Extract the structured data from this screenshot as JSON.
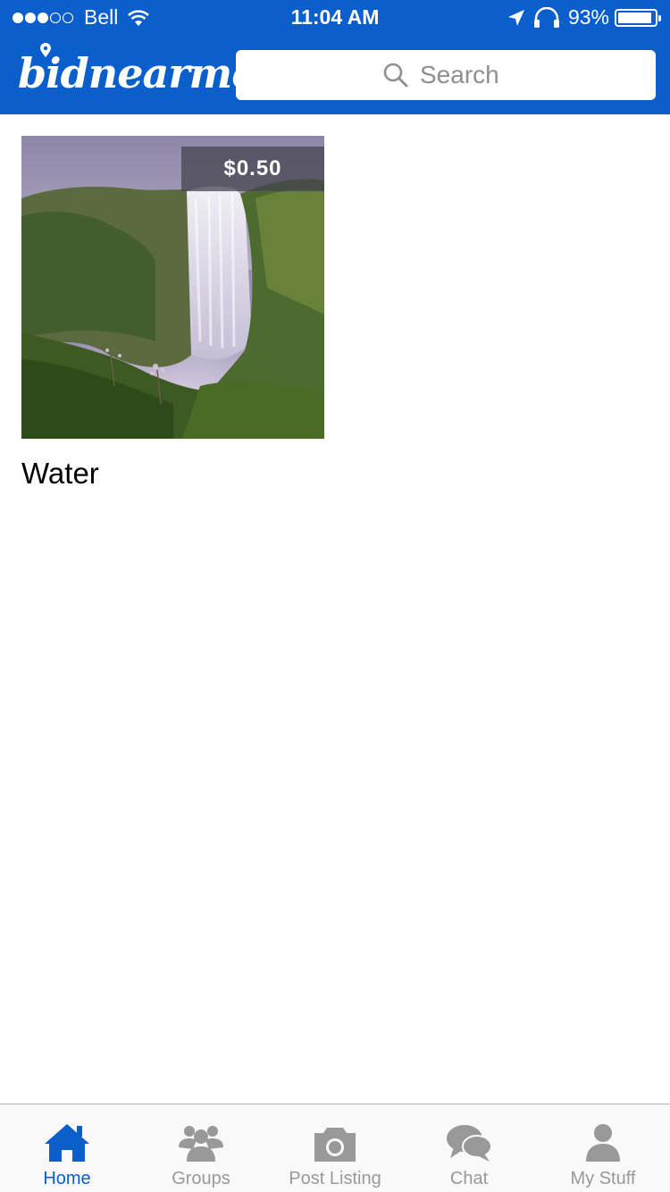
{
  "status_bar": {
    "carrier": "Bell",
    "time": "11:04 AM",
    "battery": "93%",
    "battery_level": 0.93
  },
  "header": {
    "logo_text": "bidnearme",
    "search_placeholder": "Search"
  },
  "listings": [
    {
      "title": "Water",
      "price": "$0.50",
      "image": "waterfall"
    }
  ],
  "tab_bar": {
    "tabs": [
      {
        "label": "Home",
        "icon": "home-icon",
        "active": true
      },
      {
        "label": "Groups",
        "icon": "groups-icon",
        "active": false
      },
      {
        "label": "Post Listing",
        "icon": "camera-icon",
        "active": false
      },
      {
        "label": "Chat",
        "icon": "chat-icon",
        "active": false
      },
      {
        "label": "My Stuff",
        "icon": "user-icon",
        "active": false
      }
    ]
  },
  "colors": {
    "brand": "#0a5fcd",
    "tab_inactive": "#999999",
    "tab_active": "#0a5fcd"
  }
}
